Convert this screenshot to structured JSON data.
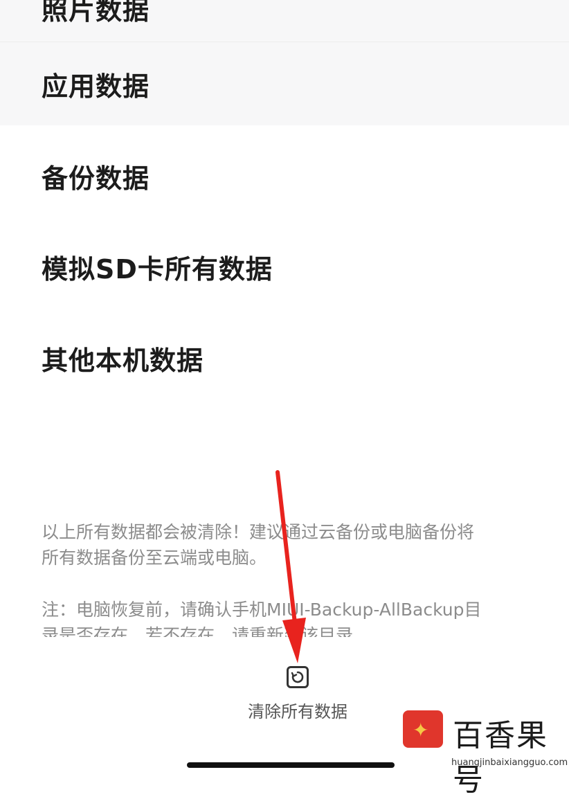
{
  "items": [
    "照片数据",
    "应用数据",
    "备份数据",
    "模拟SD卡所有数据",
    "其他本机数据"
  ],
  "notice": {
    "line1": "以上所有数据都会被清除！建议通过云备份或电脑备份将",
    "line2": "所有数据备份至云端或电脑。",
    "note1": "注：电脑恢复前，请确认手机MIUI-Backup-AllBackup目",
    "note2": "录是否存在，若不存在，请重新建该目录"
  },
  "clear_button": {
    "label": "清除所有数据",
    "icon": "restore-icon"
  },
  "watermark": {
    "title": "百香果号",
    "url": "huangjinbaixiangguo.com",
    "logo_color": "#e0362c"
  },
  "colors": {
    "arrow": "#e8231e",
    "row_bg": "#f7f7f8"
  }
}
